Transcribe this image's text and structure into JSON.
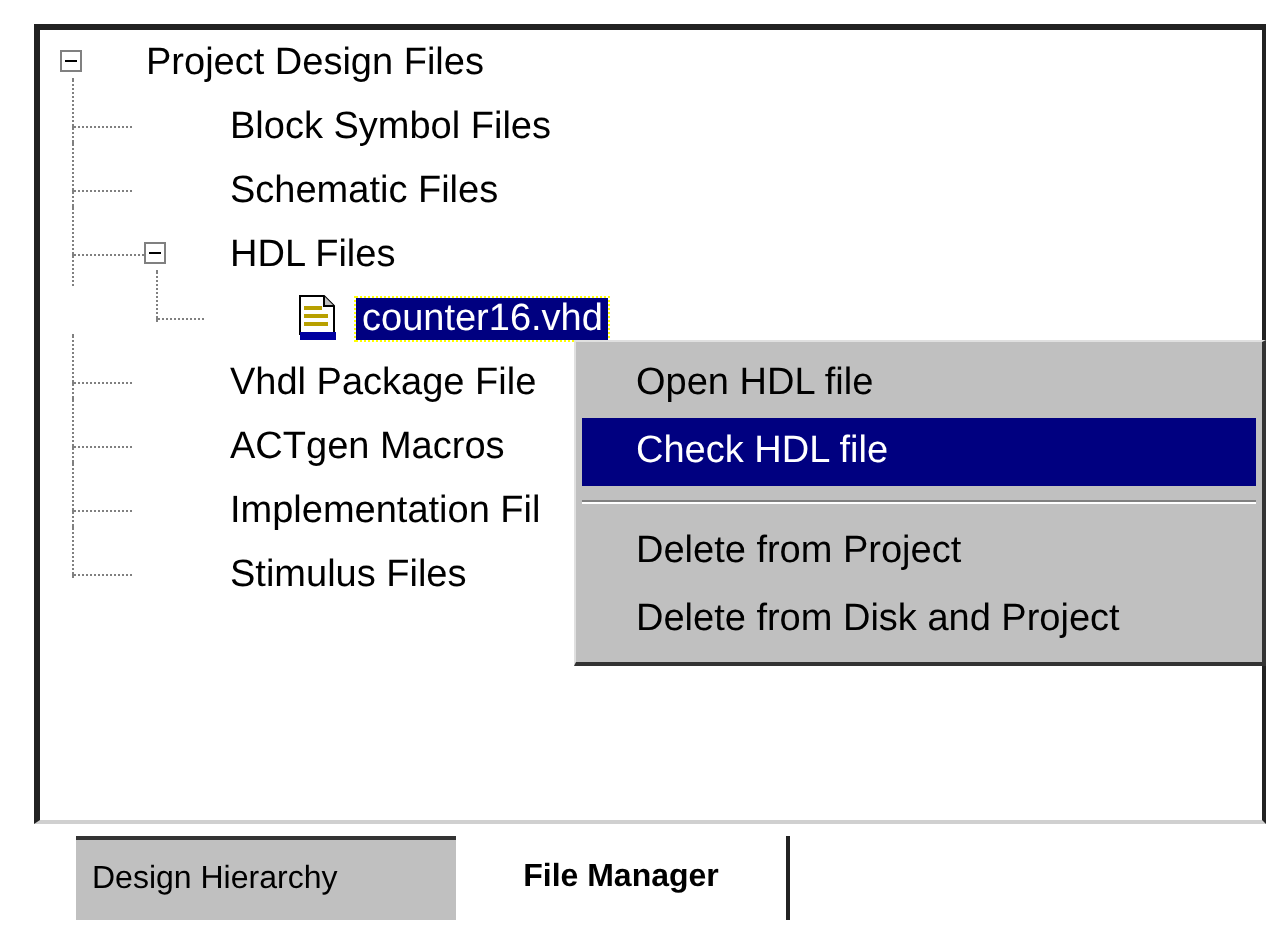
{
  "tree": [
    {
      "label": "Project Design Files",
      "expanded": true,
      "selected": false,
      "children": [
        {
          "label": "Block Symbol Files",
          "selected": false
        },
        {
          "label": "Schematic Files",
          "selected": false
        },
        {
          "label": "HDL Files",
          "expanded": true,
          "selected": false,
          "children": [
            {
              "label": "counter16.vhd",
              "kind": "hdl-file",
              "selected": true
            }
          ]
        },
        {
          "label": "Vhdl Package File",
          "selected": false
        },
        {
          "label": "ACTgen Macros",
          "selected": false
        },
        {
          "label": "Implementation Fil",
          "selected": false
        },
        {
          "label": "Stimulus Files",
          "selected": false
        }
      ]
    }
  ],
  "context_menu": {
    "items": [
      {
        "label": "Open HDL file",
        "selected": false
      },
      {
        "label": "Check HDL file",
        "selected": true
      },
      {
        "kind": "separator"
      },
      {
        "label": "Delete from Project",
        "selected": false
      },
      {
        "label": "Delete from Disk and Project",
        "selected": false
      }
    ]
  },
  "tabs": [
    {
      "label": "Design Hierarchy",
      "selected": false
    },
    {
      "label": "File Manager",
      "selected": true
    }
  ]
}
